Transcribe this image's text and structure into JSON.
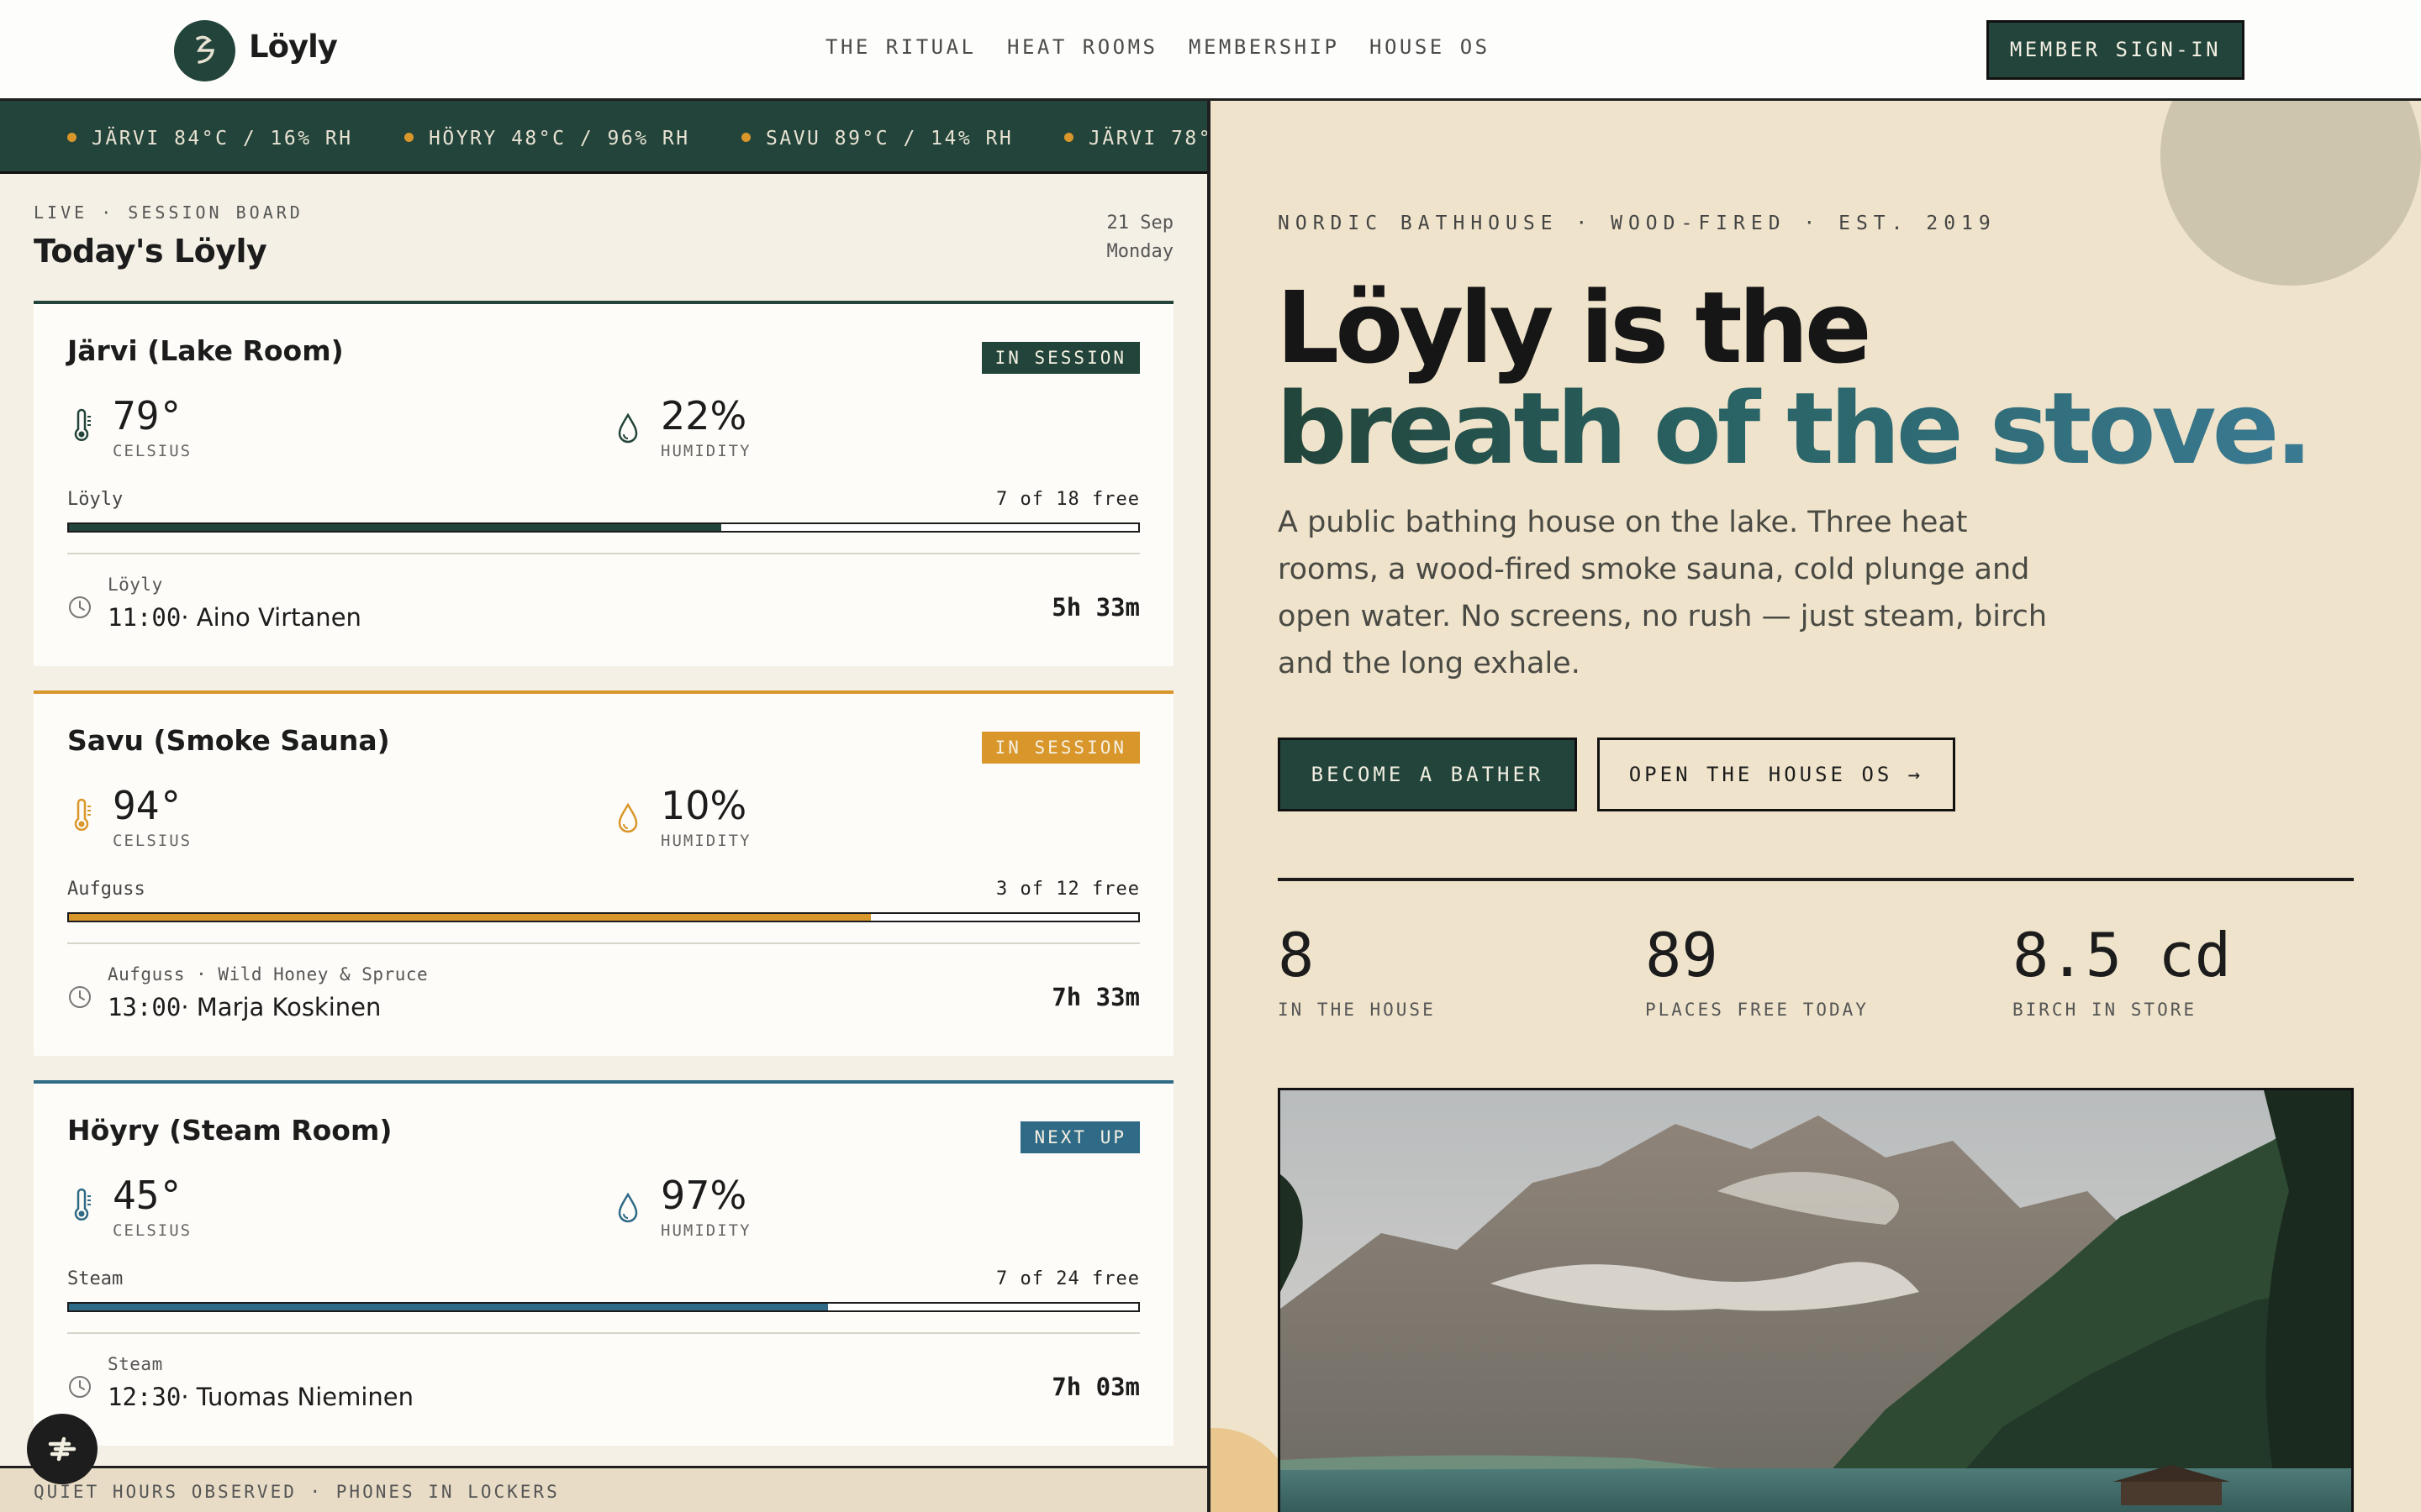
{
  "header": {
    "brand": "Löyly",
    "nav": [
      "THE RITUAL",
      "HEAT ROOMS",
      "MEMBERSHIP",
      "HOUSE OS"
    ],
    "signin": "MEMBER SIGN-IN"
  },
  "ticker": [
    "JÄRVI 84°C / 16% RH",
    "HÖYRY 48°C / 96% RH",
    "SAVU 89°C / 14% RH",
    "JÄRVI 78°"
  ],
  "board": {
    "kicker": "LIVE · SESSION BOARD",
    "title": "Today's Löyly",
    "date": "21 Sep",
    "weekday": "Monday",
    "rooms": [
      {
        "name": "Järvi (Lake Room)",
        "status": "IN SESSION",
        "temp": "79°",
        "temp_unit": "CELSIUS",
        "humidity": "22%",
        "humidity_unit": "HUMIDITY",
        "ritual": "Löyly",
        "free": "7 of 18 free",
        "occupancy": 0.61,
        "session_sub": "Löyly",
        "session_time": "11:00",
        "session_host": "· Aino Virtanen",
        "duration": "5h 33m",
        "color": "#22443a"
      },
      {
        "name": "Savu (Smoke Sauna)",
        "status": "IN SESSION",
        "temp": "94°",
        "temp_unit": "CELSIUS",
        "humidity": "10%",
        "humidity_unit": "HUMIDITY",
        "ritual": "Aufguss",
        "free": "3 of 12 free",
        "occupancy": 0.75,
        "session_sub": "Aufguss · Wild Honey & Spruce",
        "session_time": "13:00",
        "session_host": "· Marja Koskinen",
        "duration": "7h 33m",
        "color": "#d9962a"
      },
      {
        "name": "Höyry (Steam Room)",
        "status": "NEXT UP",
        "temp": "45°",
        "temp_unit": "CELSIUS",
        "humidity": "97%",
        "humidity_unit": "HUMIDITY",
        "ritual": "Steam",
        "free": "7 of 24 free",
        "occupancy": 0.71,
        "session_sub": "Steam",
        "session_time": "12:30",
        "session_host": "· Tuomas Nieminen",
        "duration": "7h 03m",
        "color": "#2f6a86"
      }
    ],
    "footer": "QUIET HOURS OBSERVED · PHONES IN LOCKERS"
  },
  "hero": {
    "kicker": "NORDIC BATHHOUSE · WOOD-FIRED · EST. 2019",
    "title_line1": "Löyly is the",
    "title_line2": "breath of the stove.",
    "description": "A public bathing house on the lake. Three heat rooms, a wood-fired smoke sauna, cold plunge and open water. No screens, no rush — just steam, birch and the long exhale.",
    "cta_primary": "BECOME A BATHER",
    "cta_secondary": "OPEN THE HOUSE OS →",
    "stats": [
      {
        "value": "8",
        "label": "IN THE HOUSE"
      },
      {
        "value": "89",
        "label": "PLACES FREE TODAY"
      },
      {
        "value": "8.5 cd",
        "label": "BIRCH IN STORE"
      }
    ]
  },
  "colors": {
    "forest": "#22443a",
    "amber": "#d9962a",
    "steam_blue": "#2f6a86",
    "cream": "#efe3cb"
  }
}
